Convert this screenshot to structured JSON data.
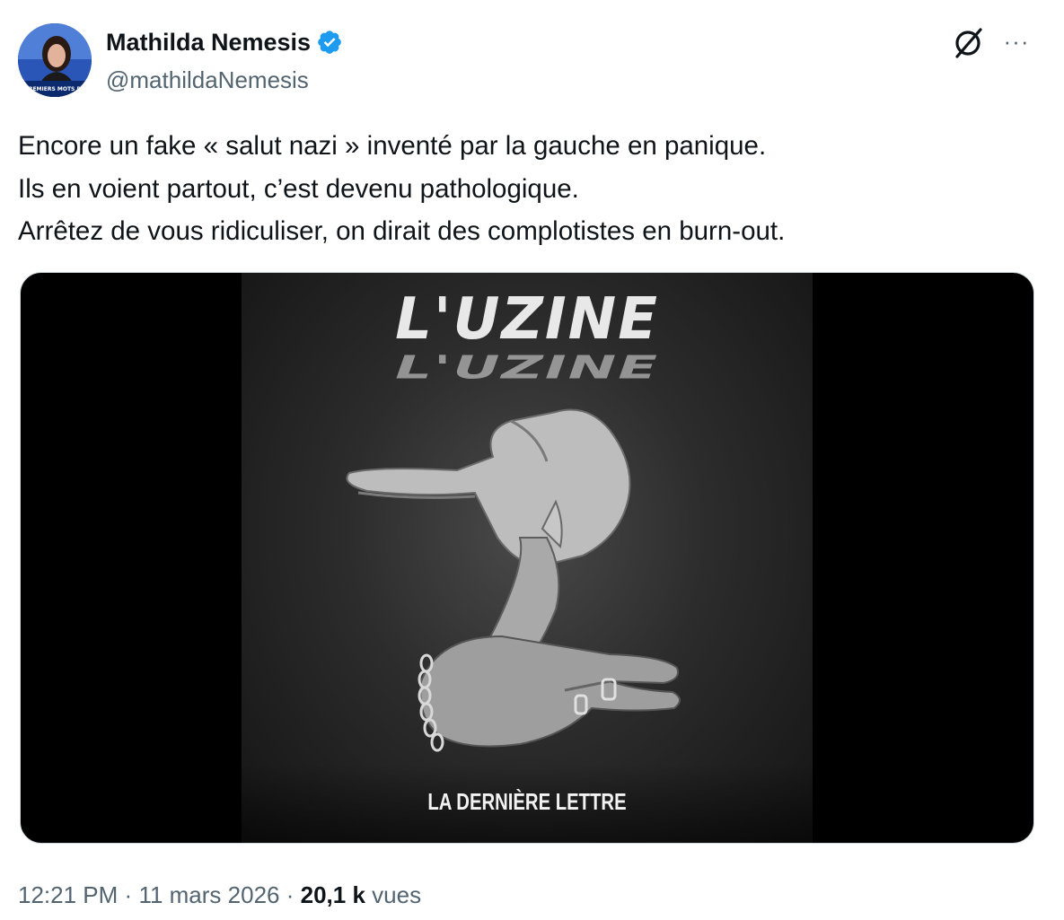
{
  "author": {
    "display_name": "Mathilda Nemesis",
    "handle": "@mathildaNemesis",
    "verified": true,
    "avatar_caption": "PREMIERS MOTS DE"
  },
  "actions": {
    "grok_icon": "grok-icon",
    "more_label": "···"
  },
  "tweet": {
    "lines": [
      "Encore un fake « salut nazi » inventé par la gauche en panique.",
      "Ils en voient partout, c’est devenu pathologique.",
      "Arrêtez de vous ridiculiser, on dirait des complotistes en burn-out."
    ]
  },
  "media": {
    "logo_text": "L'UZINE",
    "subtitle": "LA DERNIÈRE LETTRE"
  },
  "meta": {
    "time": "12:21 PM",
    "separator": "·",
    "date": "11 mars 2026",
    "views_count": "20,1 k",
    "views_label": "vues"
  },
  "colors": {
    "primary_text": "#0f1419",
    "secondary_text": "#536471",
    "verified_blue": "#1d9bf0",
    "border": "#cfd9de"
  }
}
